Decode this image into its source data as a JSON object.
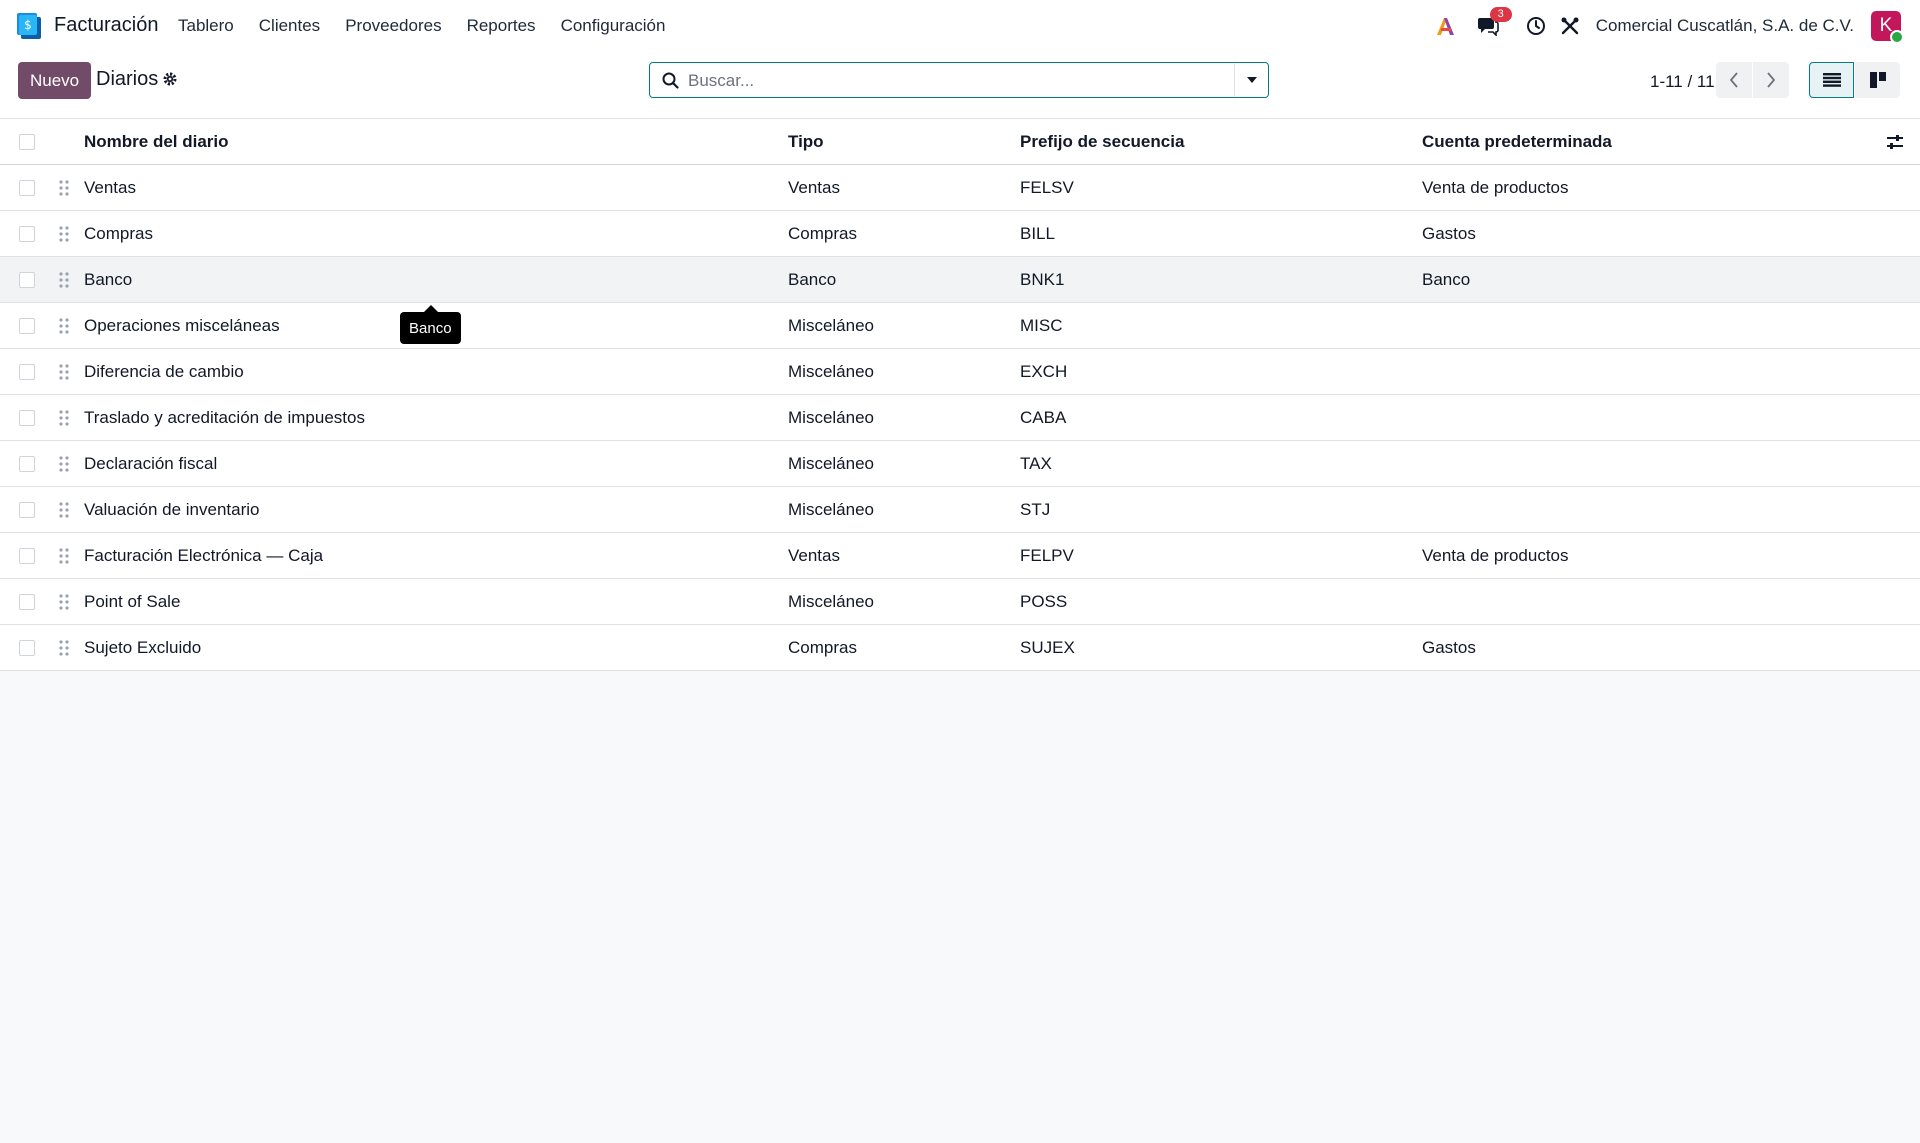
{
  "navbar": {
    "app_name": "Facturación",
    "menu": [
      "Tablero",
      "Clientes",
      "Proveedores",
      "Reportes",
      "Configuración"
    ],
    "messages_badge": "3",
    "company": "Comercial Cuscatlán, S.A. de C.V.",
    "avatar_letter": "K",
    "icons": [
      "app-logo-icon",
      "ai-icon",
      "chat-icon",
      "clock-icon",
      "tools-icon"
    ]
  },
  "control_panel": {
    "new_label": "Nuevo",
    "title": "Diarios",
    "search_placeholder": "Buscar...",
    "pager": "1-11 / 11"
  },
  "table": {
    "columns": [
      "Nombre del diario",
      "Tipo",
      "Prefijo de secuencia",
      "Cuenta predeterminada"
    ],
    "rows": [
      {
        "name": "Ventas",
        "type": "Ventas",
        "prefix": "FELSV",
        "account": "Venta de productos"
      },
      {
        "name": "Compras",
        "type": "Compras",
        "prefix": "BILL",
        "account": "Gastos"
      },
      {
        "name": "Banco",
        "type": "Banco",
        "prefix": "BNK1",
        "account": "Banco"
      },
      {
        "name": "Operaciones misceláneas",
        "type": "Misceláneo",
        "prefix": "MISC",
        "account": ""
      },
      {
        "name": "Diferencia de cambio",
        "type": "Misceláneo",
        "prefix": "EXCH",
        "account": ""
      },
      {
        "name": "Traslado y acreditación de impuestos",
        "type": "Misceláneo",
        "prefix": "CABA",
        "account": ""
      },
      {
        "name": "Declaración fiscal",
        "type": "Misceláneo",
        "prefix": "TAX",
        "account": ""
      },
      {
        "name": "Valuación de inventario",
        "type": "Misceláneo",
        "prefix": "STJ",
        "account": ""
      },
      {
        "name": "Facturación Electrónica — Caja",
        "type": "Ventas",
        "prefix": "FELPV",
        "account": "Venta de productos"
      },
      {
        "name": "Point of Sale",
        "type": "Misceláneo",
        "prefix": "POSS",
        "account": ""
      },
      {
        "name": "Sujeto Excluido",
        "type": "Compras",
        "prefix": "SUJEX",
        "account": "Gastos"
      }
    ]
  },
  "tooltip": "Banco",
  "colors": {
    "primary": "#714b67",
    "accent": "#017e84",
    "badge": "#dc3545",
    "avatar": "#c2185b"
  }
}
